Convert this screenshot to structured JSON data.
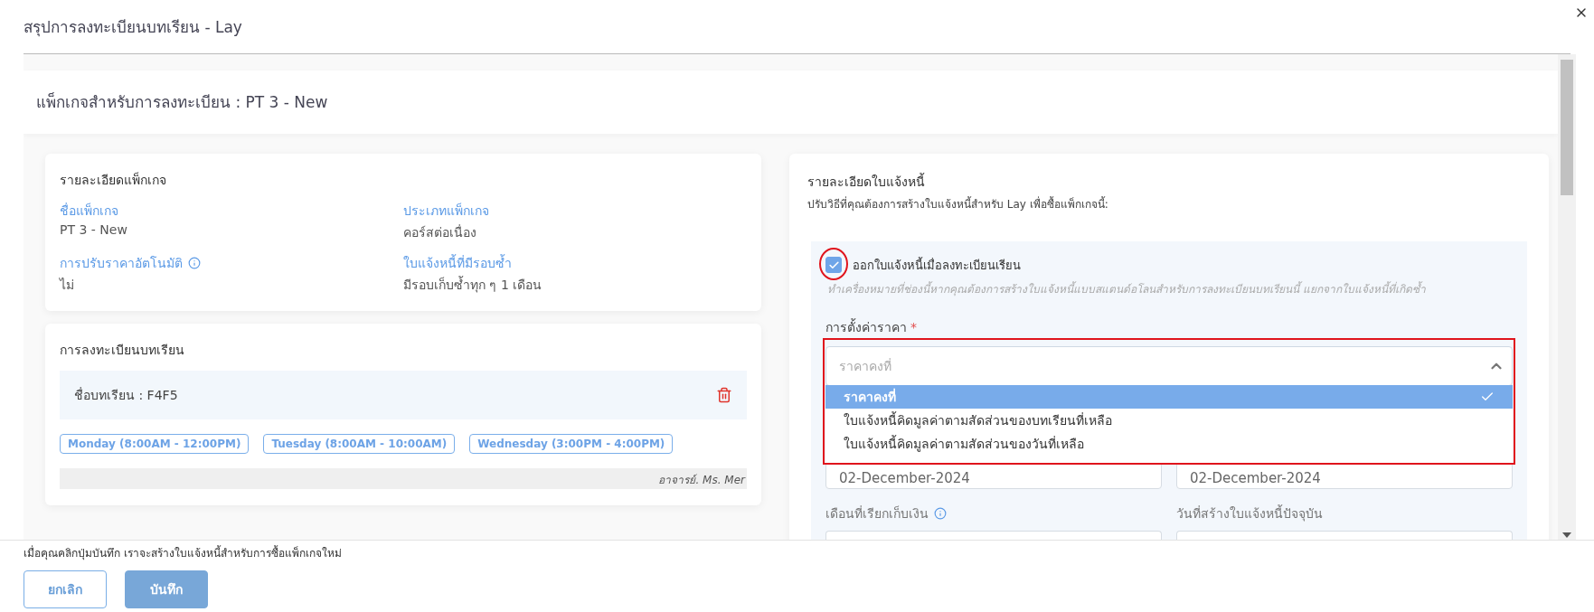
{
  "dialog": {
    "title": "สรุปการลงทะเบียนบทเรียน - Lay"
  },
  "package_header": "แพ็กเกจสำหรับการลงทะเบียน : PT 3 - New",
  "package_details": {
    "title": "รายละเอียดแพ็กเกจ",
    "fields": [
      {
        "label": "ชื่อแพ็กเกจ",
        "value": "PT 3 - New",
        "info": false
      },
      {
        "label": "ประเภทแพ็กเกจ",
        "value": "คอร์สต่อเนื่อง",
        "info": false
      },
      {
        "label": "การปรับราคาอัตโนมัติ",
        "value": "ไม่",
        "info": true
      },
      {
        "label": "ใบแจ้งหนี้ที่มีรอบซ้ำ",
        "value": "มีรอบเก็บซ้ำทุก ๆ 1 เดือน",
        "info": false
      }
    ]
  },
  "lesson_enrollment": {
    "title": "การลงทะเบียนบทเรียน",
    "lesson": "ชื่อบทเรียน : F4F5",
    "schedule": [
      "Monday (8:00AM - 12:00PM)",
      "Tuesday (8:00AM - 10:00AM)",
      "Wednesday (3:00PM - 4:00PM)"
    ],
    "teacher": "อาจารย์. Ms. Mer"
  },
  "invoice_details": {
    "title": "รายละเอียดใบแจ้งหนี้",
    "subtitle": "ปรับวิธีที่คุณต้องการสร้างใบแจ้งหนี้สำหรับ Lay เพื่อซื้อแพ็กเกจนี้:",
    "option": {
      "label": "ออกใบแจ้งหนี้เมื่อลงทะเบียนเรียน",
      "checked": true,
      "highlighted": true,
      "hint": "ทำเครื่องหมายที่ช่องนี้หากคุณต้องการสร้างใบแจ้งหนี้แบบสแตนด์อโลนสำหรับการลงทะเบียนบทเรียนนี้ แยกจากใบแจ้งหนี้ที่เกิดซ้ำ"
    },
    "price_setting": {
      "label": "การตั้งค่าราคา",
      "required_mark": "*",
      "placeholder": "ราคาคงที่",
      "expanded": true,
      "highlighted": true,
      "options": [
        {
          "label": "ราคาคงที่",
          "selected": true
        },
        {
          "label": "ใบแจ้งหนี้คิดมูลค่าตามสัดส่วนของบทเรียนที่เหลือ",
          "selected": false
        },
        {
          "label": "ใบแจ้งหนี้คิดมูลค่าตามสัดส่วนของวันที่เหลือ",
          "selected": false
        }
      ]
    },
    "date_fields": [
      {
        "value": "02-December-2024"
      },
      {
        "value": "02-December-2024"
      }
    ],
    "bottom_fields": [
      {
        "label": "เดือนที่เรียกเก็บเงิน",
        "info": true
      },
      {
        "label": "วันที่สร้างใบแจ้งหนี้ปัจจุบัน",
        "info": false
      }
    ]
  },
  "footer": {
    "note": "เมื่อคุณคลิกปุ่มบันทึก เราจะสร้างใบแจ้งหนี้สำหรับการซื้อแพ็กเกจใหม่",
    "buttons": [
      {
        "label": "ยกเลิก",
        "kind": "secondary"
      },
      {
        "label": "บันทึก",
        "kind": "primary"
      }
    ]
  }
}
